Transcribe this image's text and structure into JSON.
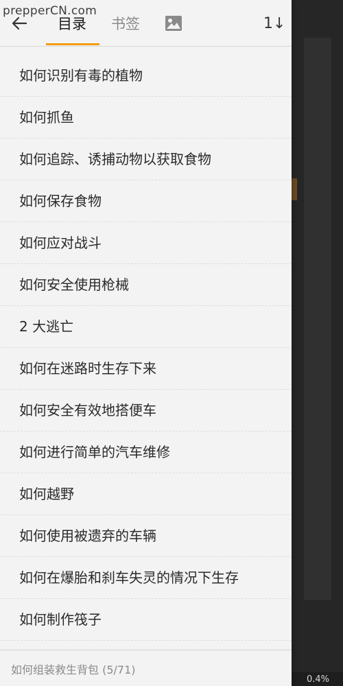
{
  "watermark": "prepperCN.com",
  "header": {
    "tabs": [
      {
        "label": "目录",
        "active": true
      },
      {
        "label": "书签",
        "active": false
      }
    ],
    "sort_label": "1↓"
  },
  "toc": {
    "items": [
      "如何识别有毒的植物",
      "如何抓鱼",
      "如何追踪、诱捕动物以获取食物",
      "如何保存食物",
      "如何应对战斗",
      "如何安全使用枪械",
      "2 大逃亡",
      "如何在迷路时生存下来",
      "如何安全有效地搭便车",
      "如何进行简单的汽车维修",
      "如何越野",
      "如何使用被遗弃的车辆",
      "如何在爆胎和刹车失灵的情况下生存",
      "如何制作筏子"
    ]
  },
  "footer": {
    "current_chapter": "如何组装救生背包 (5/71)"
  },
  "reader": {
    "progress": "0.4%"
  },
  "colors": {
    "accent": "#f39c12",
    "drawer_bg": "#f3f3f3",
    "reader_bg": "#262626"
  }
}
